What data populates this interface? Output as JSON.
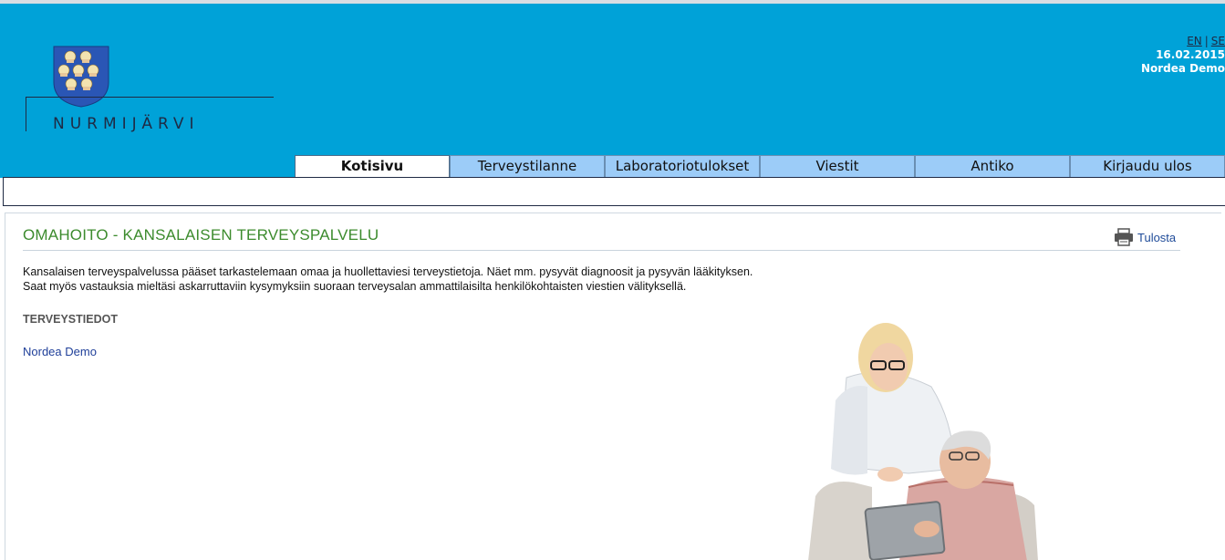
{
  "header": {
    "logo_text": "NURMIJÄRVI",
    "lang_en": "EN",
    "lang_se": "SE",
    "lang_separator": "|",
    "date": "16.02.2015",
    "user_name": "Nordea Demo"
  },
  "tabs": [
    {
      "label": "Kotisivu",
      "active": true
    },
    {
      "label": "Terveystilanne",
      "active": false
    },
    {
      "label": "Laboratoriotulokset",
      "active": false
    },
    {
      "label": "Viestit",
      "active": false
    },
    {
      "label": "Antiko",
      "active": false
    },
    {
      "label": "Kirjaudu ulos",
      "active": false
    }
  ],
  "main": {
    "title": "OMAHOITO - KANSALAISEN TERVEYSPALVELU",
    "print_label": "Tulosta",
    "intro_line1": "Kansalaisen terveyspalvelussa pääset tarkastelemaan omaa ja huollettaviesi terveystietoja. Näet mm. pysyvät diagnoosit ja pysyvän lääkityksen.",
    "intro_line2": "Saat myös vastauksia mieltäsi askarruttaviin kysymyksiin suoraan terveysalan ammattilaisilta henkilökohtaisten viestien välityksellä.",
    "section_heading": "TERVEYSTIEDOT",
    "user_link": "Nordea Demo"
  },
  "colors": {
    "header_bg": "#00a2d8",
    "tab_bg": "#9cccf8",
    "title_green": "#3c8b2d",
    "link_blue": "#1f3f99"
  }
}
